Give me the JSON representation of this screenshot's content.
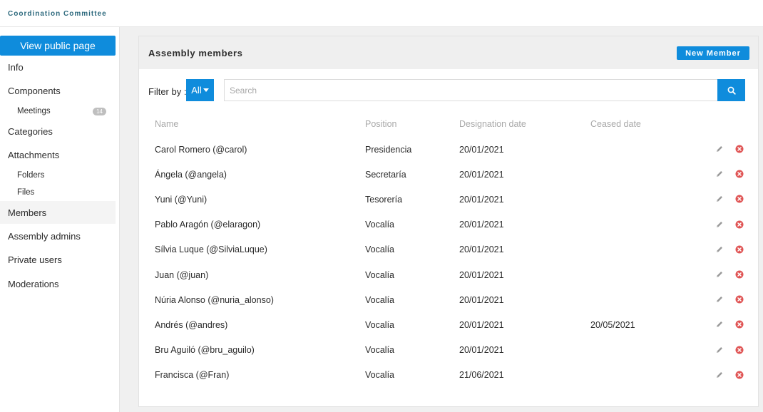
{
  "header": {
    "brand": "Coordination Committee"
  },
  "sidebar": {
    "public_button": "View public page",
    "items": [
      {
        "label": "Info"
      },
      {
        "label": "Components"
      },
      {
        "label": "Meetings",
        "badge": "14"
      },
      {
        "label": "Categories"
      },
      {
        "label": "Attachments"
      },
      {
        "label": "Folders"
      },
      {
        "label": "Files"
      },
      {
        "label": "Members"
      },
      {
        "label": "Assembly admins"
      },
      {
        "label": "Private users"
      },
      {
        "label": "Moderations"
      }
    ]
  },
  "main": {
    "title": "Assembly members",
    "new_button": "New Member",
    "filter_label": "Filter by :",
    "filter_value": "All",
    "search_placeholder": "Search",
    "columns": [
      "Name",
      "Position",
      "Designation date",
      "Ceased date"
    ],
    "rows": [
      {
        "name": "Carol Romero (@carol)",
        "position": "Presidencia",
        "designation": "20/01/2021",
        "ceased": ""
      },
      {
        "name": "Ángela (@angela)",
        "position": "Secretaría",
        "designation": "20/01/2021",
        "ceased": ""
      },
      {
        "name": "Yuni (@Yuni)",
        "position": "Tesorería",
        "designation": "20/01/2021",
        "ceased": ""
      },
      {
        "name": "Pablo Aragón (@elaragon)",
        "position": "Vocalía",
        "designation": "20/01/2021",
        "ceased": ""
      },
      {
        "name": "Sílvia Luque (@SilviaLuque)",
        "position": "Vocalía",
        "designation": "20/01/2021",
        "ceased": ""
      },
      {
        "name": "Juan (@juan)",
        "position": "Vocalía",
        "designation": "20/01/2021",
        "ceased": ""
      },
      {
        "name": "Núria Alonso (@nuria_alonso)",
        "position": "Vocalía",
        "designation": "20/01/2021",
        "ceased": ""
      },
      {
        "name": "Andrés (@andres)",
        "position": "Vocalía",
        "designation": "20/01/2021",
        "ceased": "20/05/2021"
      },
      {
        "name": "Bru Aguiló (@bru_aguilo)",
        "position": "Vocalía",
        "designation": "20/01/2021",
        "ceased": ""
      },
      {
        "name": "Francisca (@Fran)",
        "position": "Vocalía",
        "designation": "21/06/2021",
        "ceased": ""
      }
    ],
    "row_actions": [
      "pencil-icon",
      "delete-icon"
    ]
  },
  "colors": {
    "accent": "#0f8cdc",
    "brand": "#2e6a7e",
    "danger": "#e05555"
  }
}
